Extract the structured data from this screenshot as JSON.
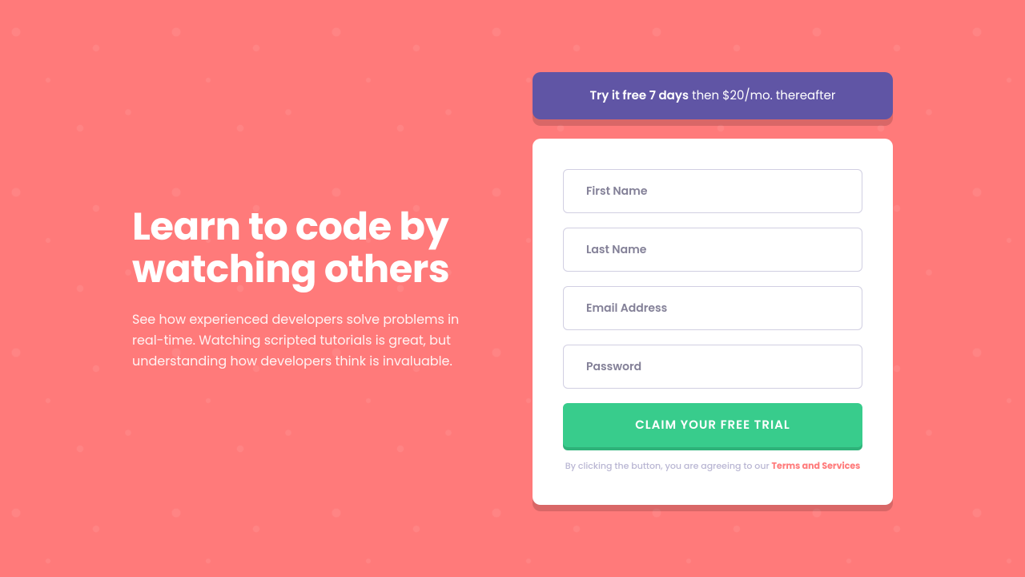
{
  "hero": {
    "headline": "Learn to code by watching others",
    "description": "See how experienced developers solve problems in real-time. Watching scripted tutorials is great, but understanding how developers think is invaluable."
  },
  "offer": {
    "bold": "Try it free 7 days",
    "rest": " then $20/mo. thereafter"
  },
  "form": {
    "firstName": {
      "placeholder": "First Name",
      "value": ""
    },
    "lastName": {
      "placeholder": "Last Name",
      "value": ""
    },
    "email": {
      "placeholder": "Email Address",
      "value": ""
    },
    "password": {
      "placeholder": "Password",
      "value": ""
    },
    "submitLabel": "CLAIM YOUR FREE TRIAL"
  },
  "terms": {
    "prefix": "By clicking the button, you are agreeing to our ",
    "link": "Terms and Services"
  }
}
